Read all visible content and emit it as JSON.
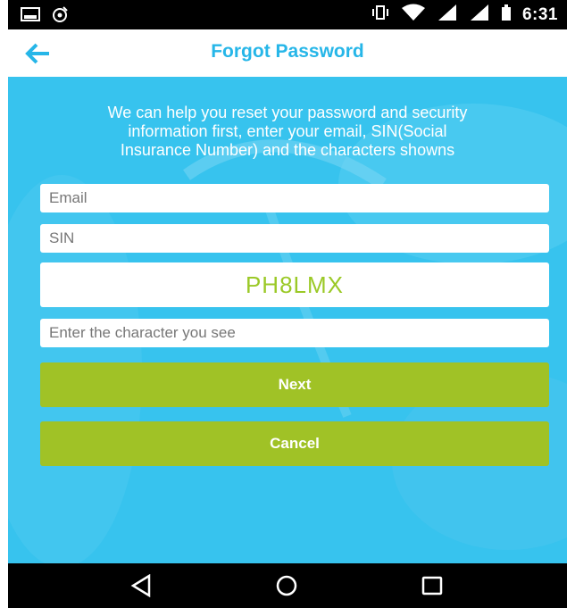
{
  "status_bar": {
    "time": "6:31",
    "icons": [
      "image-notification-icon",
      "radio-notification-icon",
      "vibrate-icon",
      "wifi-icon",
      "signal-icon",
      "signal-icon-2",
      "battery-icon"
    ]
  },
  "header": {
    "title": "Forgot Password",
    "back_icon": "back-arrow-icon"
  },
  "form": {
    "intro_line1": "We can help you reset your password and security",
    "intro_line2": "information first, enter your email, SIN(Social",
    "intro_line3": "Insurance Number) and the characters showns",
    "email_placeholder": "Email",
    "sin_placeholder": "SIN",
    "captcha_text": "PH8LMX",
    "captcha_input_placeholder": "Enter the character you see",
    "next_label": "Next",
    "cancel_label": "Cancel"
  },
  "nav_bar": {
    "buttons": [
      "back-triangle-icon",
      "home-circle-icon",
      "recents-square-icon"
    ]
  },
  "colors": {
    "accent": "#26b6e8",
    "background": "#37c3ee",
    "button": "#a0c226",
    "captcha": "#9bc927"
  }
}
